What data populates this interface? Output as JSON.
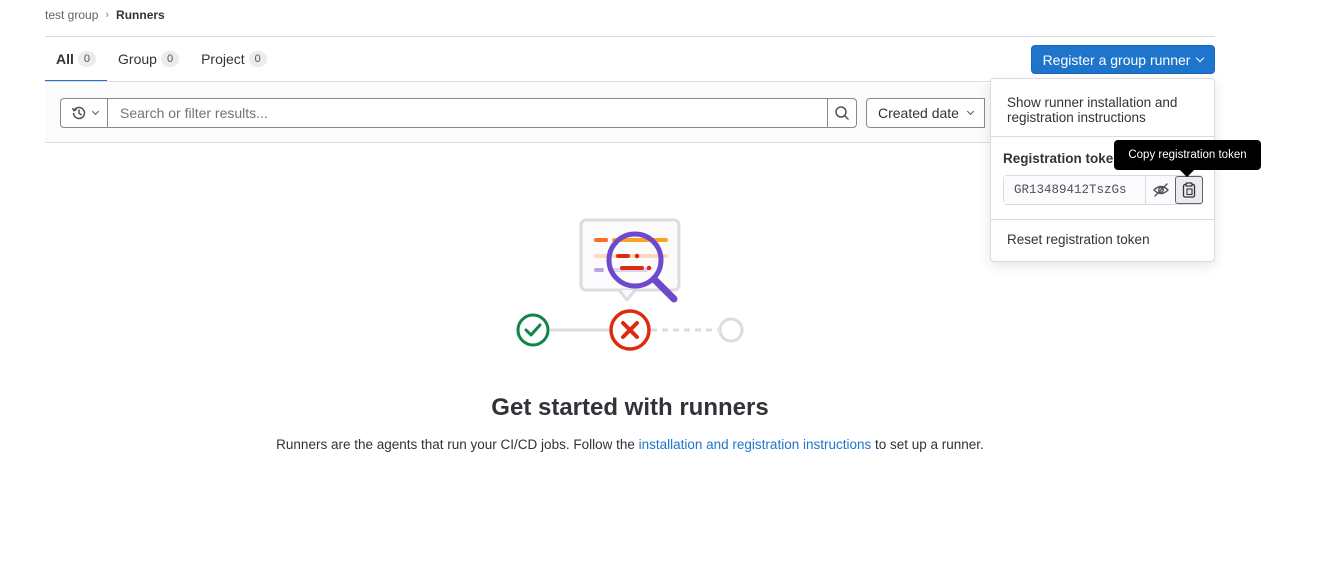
{
  "breadcrumb": {
    "parent": "test group",
    "separator": "›",
    "current": "Runners"
  },
  "tabs": [
    {
      "label": "All",
      "count": "0",
      "active": true
    },
    {
      "label": "Group",
      "count": "0",
      "active": false
    },
    {
      "label": "Project",
      "count": "0",
      "active": false
    }
  ],
  "register_button": {
    "label": "Register a group runner"
  },
  "filter": {
    "search_placeholder": "Search or filter results...",
    "sort_label": "Created date"
  },
  "dropdown": {
    "show_instructions": "Show runner installation and registration instructions",
    "token_label": "Registration token",
    "token_value": "GR13489412TszGs",
    "reset_token": "Reset registration token"
  },
  "tooltip": {
    "text": "Copy registration token"
  },
  "empty_state": {
    "title": "Get started with runners",
    "desc_before": "Runners are the agents that run your CI/CD jobs. Follow the ",
    "desc_link": "installation and registration instructions",
    "desc_after": " to set up a runner."
  },
  "colors": {
    "primary": "#1f75cb",
    "success": "#108548",
    "danger": "#dd2b0e",
    "magnifier": "#6e49cb"
  },
  "icons": [
    "history-icon",
    "chevron-down-icon",
    "search-icon",
    "eye-slash-icon",
    "copy-to-clipboard-icon",
    "check-circle-icon",
    "error-circle-icon",
    "pending-circle-icon"
  ]
}
